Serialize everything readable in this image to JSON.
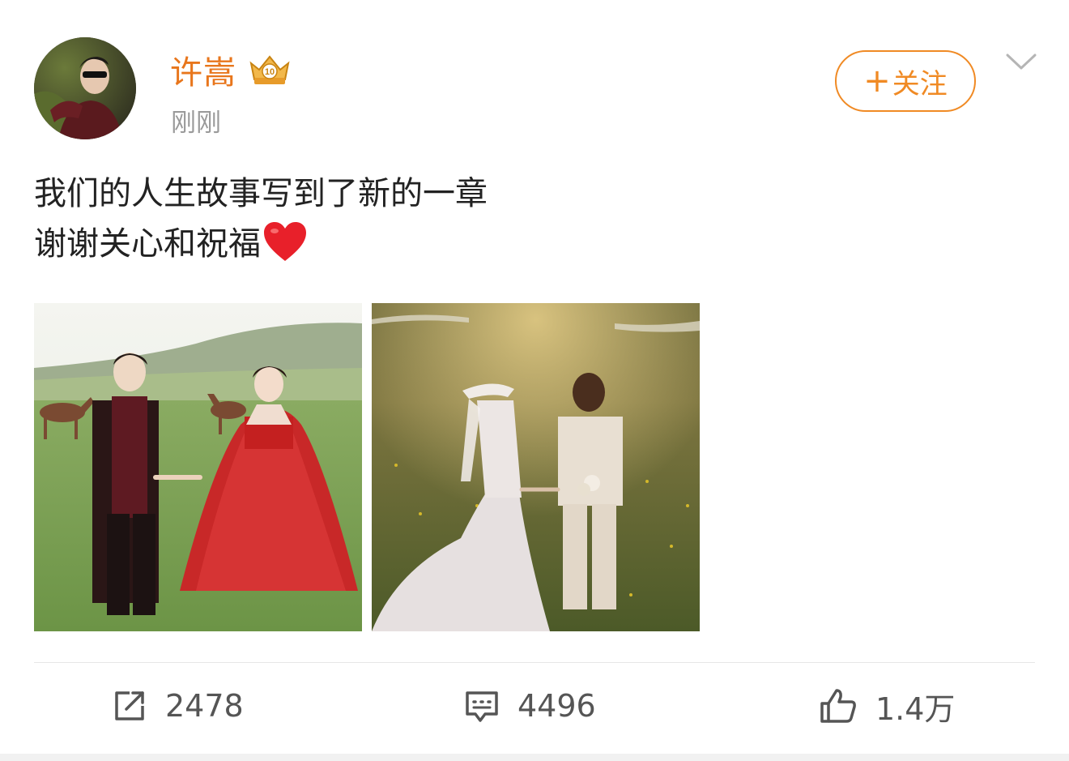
{
  "post": {
    "author": {
      "name": "许嵩",
      "badge_icon": "vip-crown-badge",
      "badge_level": "10"
    },
    "timestamp": "刚刚",
    "follow_label": "关注",
    "follow_prefix": "+",
    "text_lines": [
      "我们的人生故事写到了新的一章",
      "谢谢关心和祝福"
    ],
    "text_emoji": "red-heart-icon",
    "images": [
      {
        "description_icon": "photo"
      },
      {
        "description_icon": "photo"
      }
    ],
    "actions": {
      "repost_count": "2478",
      "comment_count": "4496",
      "like_count": "1.4万"
    }
  },
  "colors": {
    "accent": "#f08a24",
    "username": "#e8761c",
    "timestamp": "#9a9a9a",
    "text": "#222222",
    "action_text": "#555555"
  }
}
